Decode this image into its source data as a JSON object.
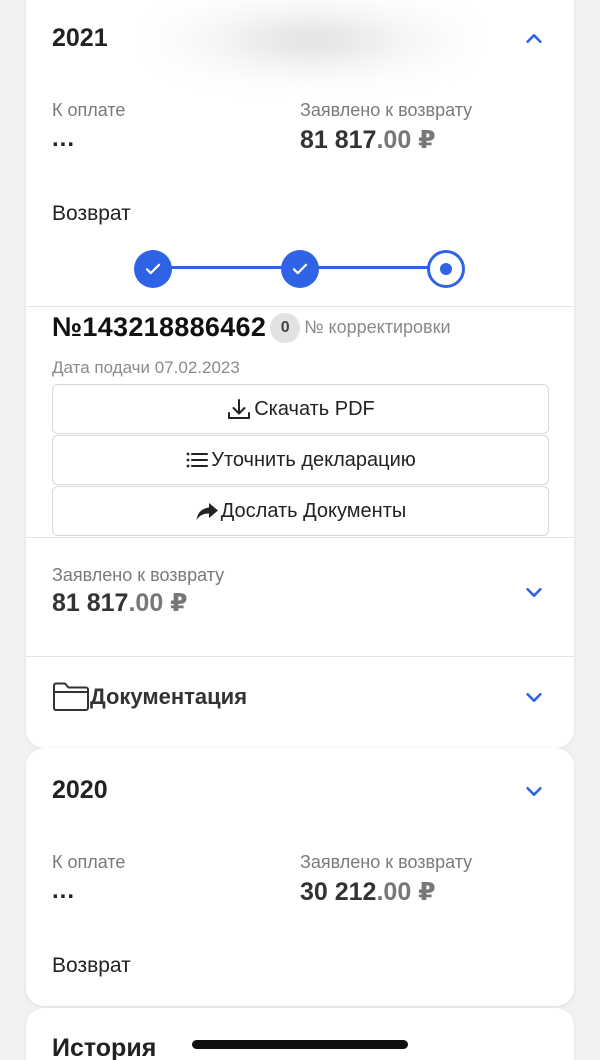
{
  "colors": {
    "accent": "#2f63e6"
  },
  "card_2021": {
    "year": "2021",
    "to_pay_label": "К оплате",
    "to_pay_value": "...",
    "claimed_label": "Заявлено к возврату",
    "claimed_int": "81 817",
    "claimed_cents": ".00 ₽",
    "refund_word": "Возврат",
    "stepper": {
      "total": 3,
      "completed": 2
    },
    "declaration_number": "№143218886462",
    "correction_count": "0",
    "correction_label": "№ корректировки",
    "submit_date": "Дата подачи 07.02.2023",
    "buttons": {
      "download": "Скачать PDF",
      "clarify": "Уточнить декларацию",
      "send_docs": "Дослать Документы"
    },
    "summary_claimed_label": "Заявлено к возврату",
    "summary_claimed_int": "81 817",
    "summary_claimed_cents": ".00 ₽",
    "documentation": "Документация"
  },
  "card_2020": {
    "year": "2020",
    "to_pay_label": "К оплате",
    "to_pay_value": "...",
    "claimed_label": "Заявлено к возврату",
    "claimed_int": "30 212",
    "claimed_cents": ".00 ₽",
    "refund_word": "Возврат"
  },
  "history": {
    "title": "История"
  }
}
